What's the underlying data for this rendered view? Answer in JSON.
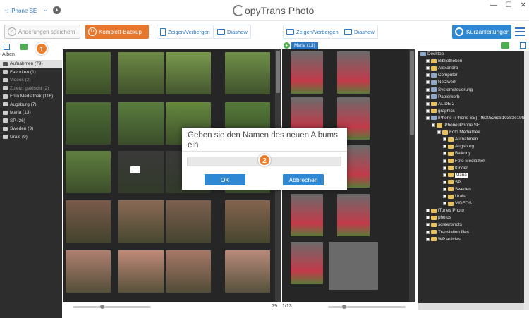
{
  "titlebar": {
    "device": "↑: iPhone SE",
    "app_title": "opyTrans Photo",
    "controls": [
      "—",
      "☐",
      "✕"
    ]
  },
  "toolbar": {
    "save_label": "Änderungen speichern",
    "backup_label": "Komplett-Backup",
    "toggle_left": "Zeigen/Verbergen",
    "slideshow_left": "Diashow",
    "toggle_right": "Zeigen/Verbergen",
    "slideshow_right": "Diashow",
    "guide_label": "Kurzanleitungen"
  },
  "sidebar": {
    "header": "Alben",
    "items": [
      {
        "label": "Aufnahmen (79)",
        "state": "selected"
      },
      {
        "label": "Favoriten (1)",
        "state": "normal"
      },
      {
        "label": "Videos (2)",
        "state": "dim"
      },
      {
        "label": "Zuletzt gelöscht (2)",
        "state": "dim"
      },
      {
        "label": "Foto Mediathek (116)",
        "state": "normal"
      },
      {
        "label": "Augsburg (7)",
        "state": "normal"
      },
      {
        "label": "Maria (13)",
        "state": "normal"
      },
      {
        "label": "SP (26)",
        "state": "normal"
      },
      {
        "label": "Sweden (9)",
        "state": "normal"
      },
      {
        "label": "Urals (9)",
        "state": "normal"
      }
    ]
  },
  "badges": {
    "step1": "1",
    "step2": "2"
  },
  "album_pane": {
    "tag": "Maria (13)",
    "counter": "1/13"
  },
  "main_pane": {
    "count": "79"
  },
  "tree": {
    "items": [
      {
        "label": "Desktop",
        "depth": 0,
        "kind": "gray"
      },
      {
        "label": "Bibliotheken",
        "depth": 1,
        "kind": "folder"
      },
      {
        "label": "Alexandra",
        "depth": 1,
        "kind": "folder"
      },
      {
        "label": "Computer",
        "depth": 1,
        "kind": "gray"
      },
      {
        "label": "Netzwerk",
        "depth": 1,
        "kind": "gray"
      },
      {
        "label": "Systemsteuerung",
        "depth": 1,
        "kind": "gray"
      },
      {
        "label": "Papierkorb",
        "depth": 1,
        "kind": "gray"
      },
      {
        "label": "AL DE 2",
        "depth": 1,
        "kind": "folder"
      },
      {
        "label": "graphics",
        "depth": 1,
        "kind": "folder"
      },
      {
        "label": "iPhone (iPhone SE) - f600526a810383e19f572c",
        "depth": 1,
        "kind": "gray"
      },
      {
        "label": "iPhone iPhone SE",
        "depth": 2,
        "kind": "folder"
      },
      {
        "label": "Foto Mediathek",
        "depth": 3,
        "kind": "folder"
      },
      {
        "label": "Aufnahmen",
        "depth": 4,
        "kind": "folder"
      },
      {
        "label": "Augsburg",
        "depth": 4,
        "kind": "folder"
      },
      {
        "label": "Balkony",
        "depth": 4,
        "kind": "folder"
      },
      {
        "label": "Foto Mediathek",
        "depth": 4,
        "kind": "folder"
      },
      {
        "label": "Kinder",
        "depth": 4,
        "kind": "folder"
      },
      {
        "label": "Maria",
        "depth": 4,
        "kind": "folder",
        "selected": true
      },
      {
        "label": "SP",
        "depth": 4,
        "kind": "folder"
      },
      {
        "label": "Sweden",
        "depth": 4,
        "kind": "folder"
      },
      {
        "label": "Urals",
        "depth": 4,
        "kind": "folder"
      },
      {
        "label": "VIDEOS",
        "depth": 4,
        "kind": "folder"
      },
      {
        "label": "iTunes Photo",
        "depth": 1,
        "kind": "folder"
      },
      {
        "label": "photos",
        "depth": 1,
        "kind": "folder"
      },
      {
        "label": "screenshots",
        "depth": 1,
        "kind": "folder"
      },
      {
        "label": "Translation files",
        "depth": 1,
        "kind": "folder"
      },
      {
        "label": "WP articles",
        "depth": 1,
        "kind": "folder"
      }
    ]
  },
  "dialog": {
    "title": "Geben sie den Namen des neuen Albums ein",
    "input_value": "",
    "ok_label": "OK",
    "cancel_label": "Abbrechen"
  },
  "colors": {
    "accent_blue": "#2f88d4",
    "backup_orange": "#e8772e",
    "badge_orange": "#ee7d2a"
  }
}
